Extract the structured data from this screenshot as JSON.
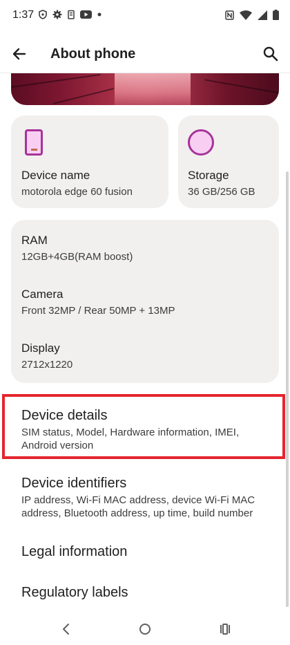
{
  "status_bar": {
    "time": "1:37",
    "left_icons": [
      "vpn-shield-icon",
      "settings-gear-icon",
      "battery-saver-icon",
      "youtube-icon",
      "dot-icon"
    ],
    "right_icons": [
      "nfc-icon",
      "wifi-icon",
      "signal-icon",
      "battery-icon"
    ]
  },
  "app_bar": {
    "title": "About phone",
    "back_icon": "arrow-back-icon",
    "search_icon": "search-icon"
  },
  "cards": {
    "device_name": {
      "label": "Device name",
      "value": "motorola edge 60 fusion",
      "icon": "phone-icon"
    },
    "storage": {
      "label": "Storage",
      "value": "36 GB/256 GB",
      "icon": "storage-circle-icon"
    },
    "specs": [
      {
        "label": "RAM",
        "value": "12GB+4GB(RAM boost)"
      },
      {
        "label": "Camera",
        "value": "Front 32MP / Rear 50MP + 13MP"
      },
      {
        "label": "Display",
        "value": "2712x1220"
      }
    ]
  },
  "list": [
    {
      "title": "Device details",
      "subtitle": "SIM status, Model, Hardware information, IMEI, Android version"
    },
    {
      "title": "Device identifiers",
      "subtitle": "IP address, Wi-Fi MAC address, device Wi-Fi MAC address, Bluetooth address, up time, build number"
    },
    {
      "title": "Legal information",
      "subtitle": ""
    },
    {
      "title": "Regulatory labels",
      "subtitle": ""
    }
  ],
  "colors": {
    "accent": "#a8329a",
    "accent_fill": "#f8cff2",
    "card_bg": "#f1f0ef",
    "highlight": "#e4252e"
  },
  "nav_bar": {
    "icons": [
      "back-nav-icon",
      "home-nav-icon",
      "recents-nav-icon"
    ]
  }
}
